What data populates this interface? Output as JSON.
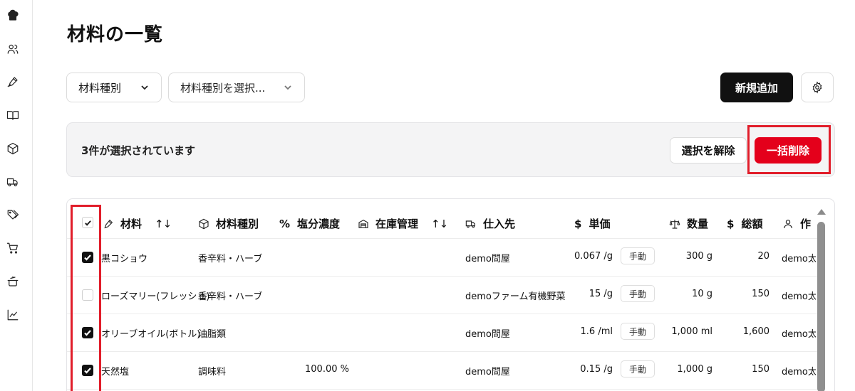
{
  "page": {
    "title": "材料の一覧"
  },
  "sidebar": {
    "icons": [
      "chef-hat-icon",
      "users-icon",
      "pen-icon",
      "book-icon",
      "box-icon",
      "truck-icon",
      "tags-icon",
      "cart-icon",
      "cooking-pot-icon",
      "chart-icon"
    ]
  },
  "filters": {
    "type_select": "材料種別",
    "type_value_select": "材料種別を選択..."
  },
  "toolbar": {
    "add_label": "新規追加"
  },
  "selection": {
    "text": "3件が選択されています",
    "clear_label": "選択を解除",
    "bulk_delete_label": "一括削除"
  },
  "table": {
    "headers": {
      "material": "材料",
      "type": "材料種別",
      "salt_symbol": "%",
      "salt": "塩分濃度",
      "stock": "在庫管理",
      "supplier": "仕入先",
      "price_symbol": "$",
      "price": "単価",
      "qty": "数量",
      "total_symbol": "$",
      "total": "総額",
      "creator": "作"
    },
    "sort_symbol": "↑↓",
    "rows": [
      {
        "checked": true,
        "name": "黒コショウ",
        "type": "香辛料・ハーブ",
        "salt": "",
        "supplier": "demo問屋",
        "price": "0.067 /g",
        "mode": "手動",
        "qty": "300 g",
        "total": "20",
        "creator": "demo太"
      },
      {
        "checked": false,
        "name": "ローズマリー(フレッシュ)",
        "type": "香辛料・ハーブ",
        "salt": "",
        "supplier": "demoファーム有機野菜",
        "price": "15 /g",
        "mode": "手動",
        "qty": "10 g",
        "total": "150",
        "creator": "demo太"
      },
      {
        "checked": true,
        "name": "オリーブオイル(ボトル)",
        "type": "油脂類",
        "salt": "",
        "supplier": "demo問屋",
        "price": "1.6 /ml",
        "mode": "手動",
        "qty": "1,000 ml",
        "total": "1,600",
        "creator": "demo太"
      },
      {
        "checked": true,
        "name": "天然塩",
        "type": "調味料",
        "salt": "100.00 %",
        "supplier": "demo問屋",
        "price": "0.15 /g",
        "mode": "手動",
        "qty": "1,000 g",
        "total": "150",
        "creator": "demo太"
      }
    ]
  },
  "colors": {
    "primary": "#111111",
    "danger": "#e4001b",
    "highlight": "#e11d2a"
  }
}
